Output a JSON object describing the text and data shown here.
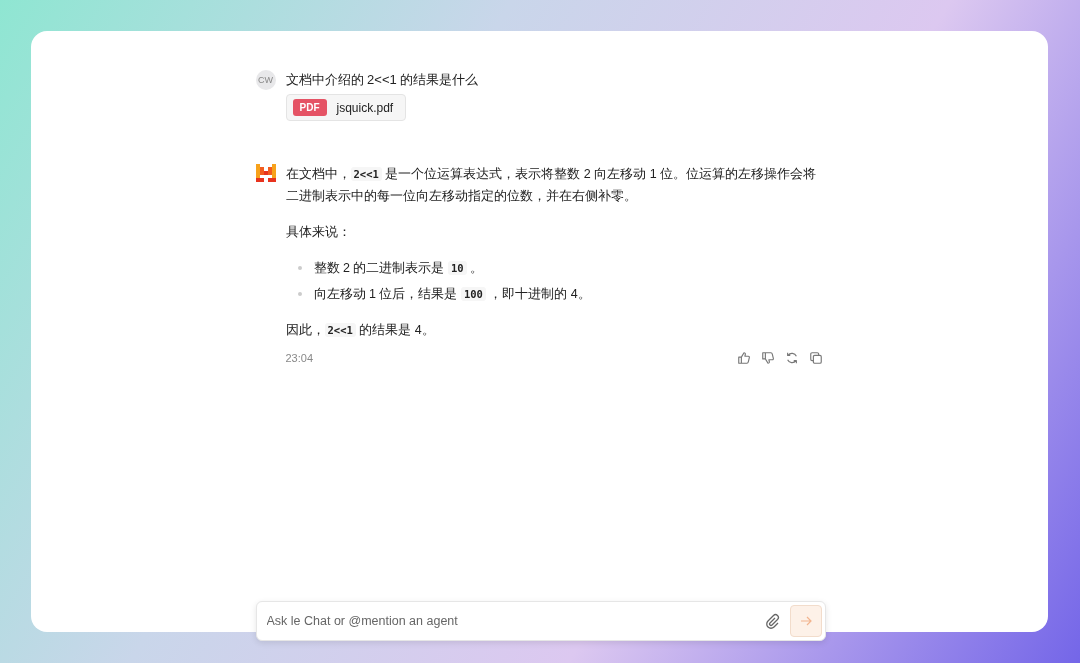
{
  "user_message": {
    "avatar": "CW",
    "text": "文档中介绍的 2<<1 的结果是什么",
    "attachment": {
      "type": "PDF",
      "name": "jsquick.pdf"
    }
  },
  "reply": {
    "blocks": [
      {
        "kind": "paragraph",
        "text": "在文档中，**2<<1** 是一个位运算表达式，表示将整数 2 向左移动 1 位。位运算的左移操作会将二进制表示中的每一位向左移动指定的位数，并在右侧补零。"
      },
      {
        "kind": "paragraph",
        "text": "具体来说："
      },
      {
        "kind": "list",
        "items": [
          "整数 2 的二进制表示是 **10** 。",
          "向左移动 1 位后，结果是 **100** ，即十进制的 4。"
        ]
      },
      {
        "kind": "paragraph",
        "text": "因此，**2<<1** 的结果是 4。"
      }
    ],
    "time": "23:04"
  },
  "composer": {
    "placeholder": "Ask le Chat or @mention an agent",
    "send_disabled": true
  }
}
